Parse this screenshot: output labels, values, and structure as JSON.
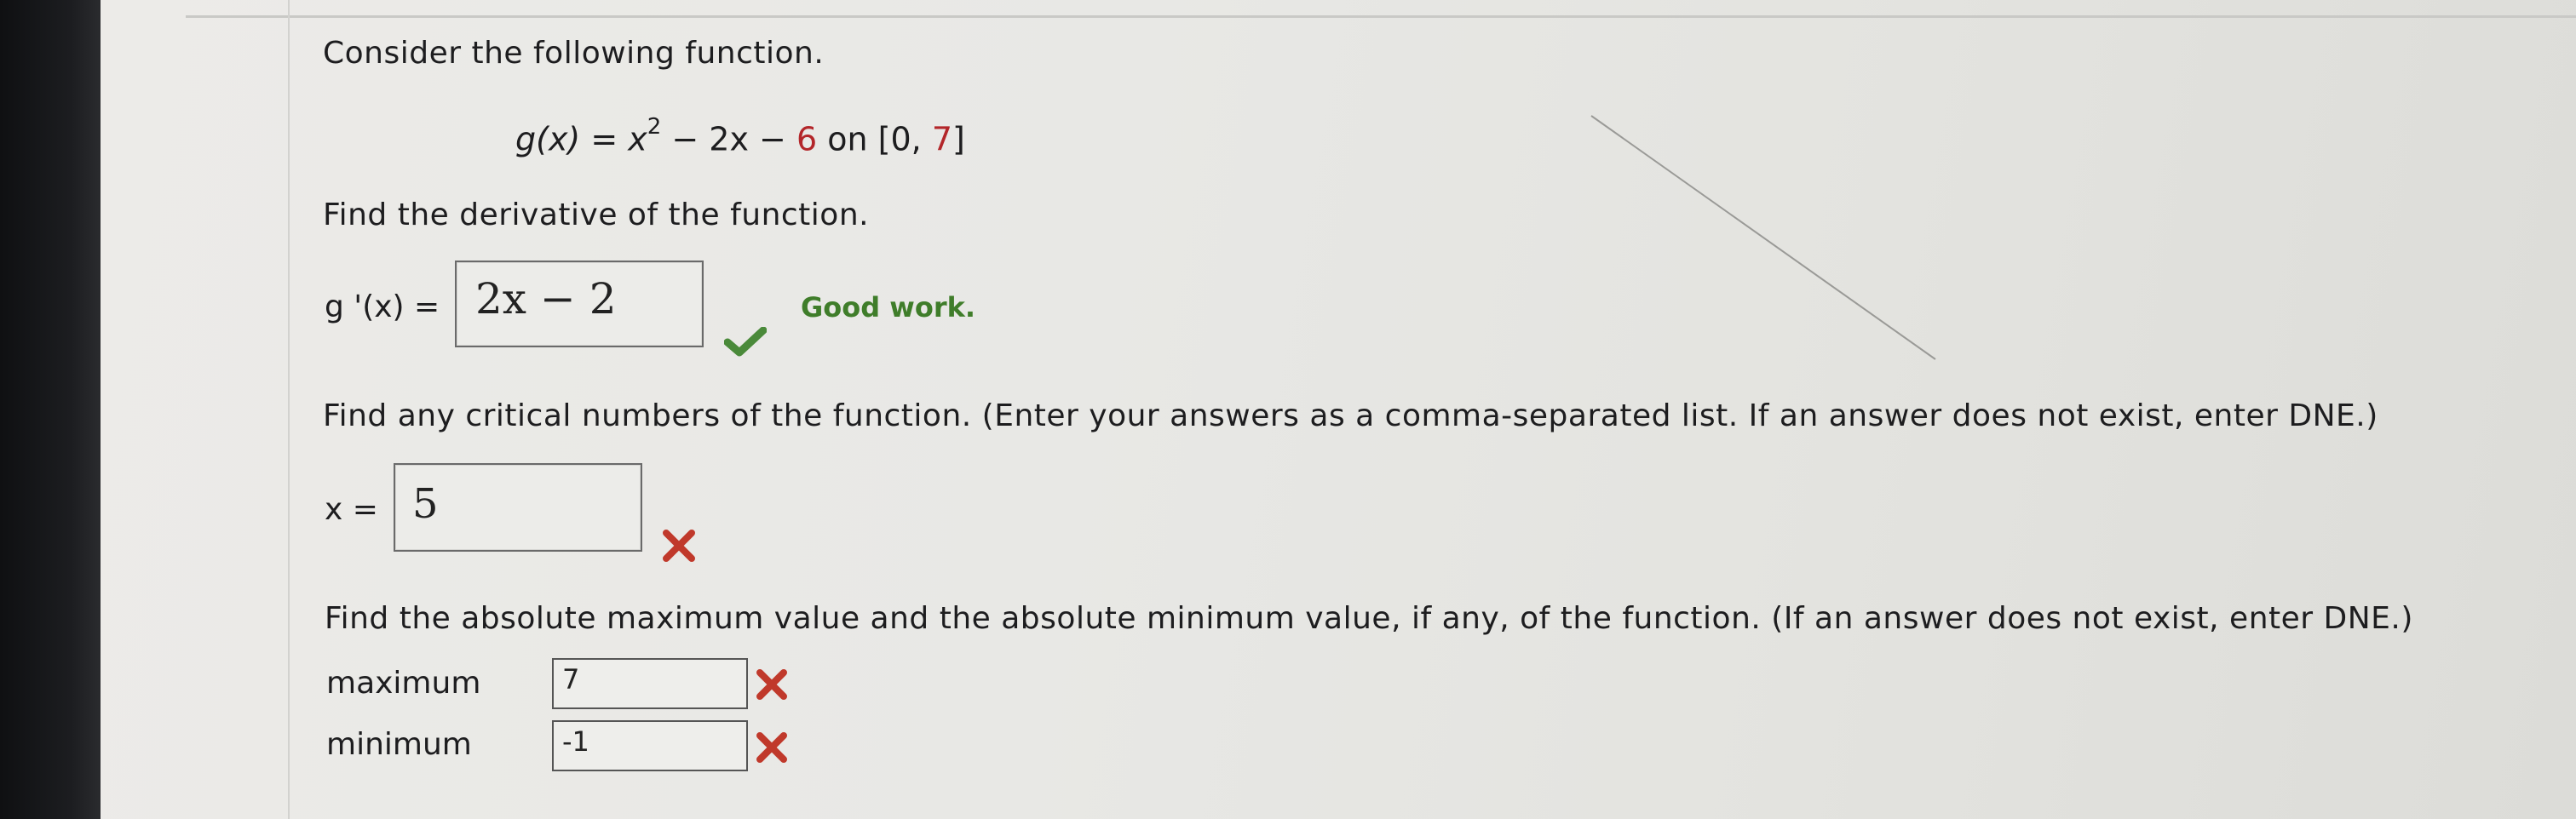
{
  "question": {
    "intro": "Consider the following function.",
    "equation": {
      "lhs": "g(x) = x",
      "exponent": "2",
      "middle": " − 2x − ",
      "constant": "6",
      "tail": " on [0, ",
      "upper": "7",
      "close": "]"
    }
  },
  "part1": {
    "prompt": "Find the derivative of the function.",
    "label": "g '(x) = ",
    "answer": "2x − 2",
    "feedback": "Good work.",
    "status_icon": "checkmark-icon",
    "status_color": "#4a8a3a"
  },
  "part2": {
    "prompt": "Find any critical numbers of the function. (Enter your answers as a comma-separated list. If an answer does not exist, enter DNE.)",
    "label": "x = ",
    "answer": "5",
    "status_icon": "x-icon",
    "status_color": "#c0392b"
  },
  "part3": {
    "prompt": "Find the absolute maximum value and the absolute minimum value, if any, of the function. (If an answer does not exist, enter DNE.)",
    "max_label": "maximum",
    "max_value": "7",
    "min_label": "minimum",
    "min_value": "-1",
    "status_icon": "x-icon",
    "status_color": "#c0392b"
  }
}
